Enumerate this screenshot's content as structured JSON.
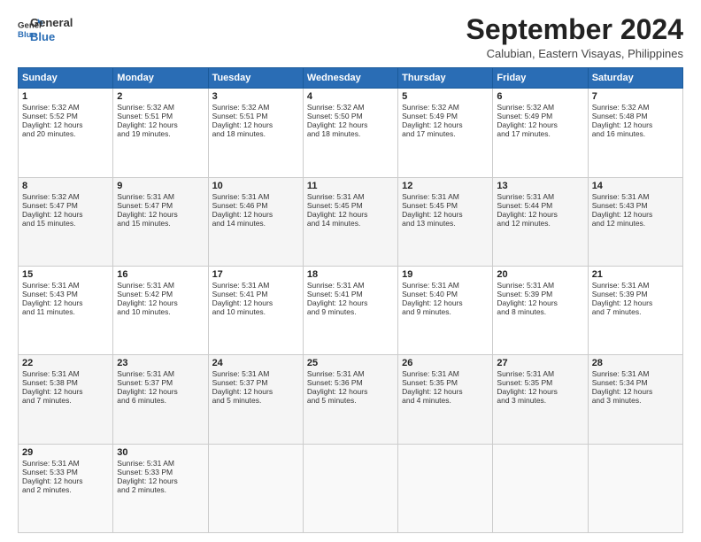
{
  "logo": {
    "line1": "General",
    "line2": "Blue"
  },
  "header": {
    "month": "September 2024",
    "location": "Calubian, Eastern Visayas, Philippines"
  },
  "weekdays": [
    "Sunday",
    "Monday",
    "Tuesday",
    "Wednesday",
    "Thursday",
    "Friday",
    "Saturday"
  ],
  "weeks": [
    [
      {
        "day": "1",
        "sun": "5:32 AM",
        "set": "5:52 PM",
        "dl": "12 hours and 20 minutes."
      },
      {
        "day": "2",
        "sun": "5:32 AM",
        "set": "5:51 PM",
        "dl": "12 hours and 19 minutes."
      },
      {
        "day": "3",
        "sun": "5:32 AM",
        "set": "5:51 PM",
        "dl": "12 hours and 18 minutes."
      },
      {
        "day": "4",
        "sun": "5:32 AM",
        "set": "5:50 PM",
        "dl": "12 hours and 18 minutes."
      },
      {
        "day": "5",
        "sun": "5:32 AM",
        "set": "5:49 PM",
        "dl": "12 hours and 17 minutes."
      },
      {
        "day": "6",
        "sun": "5:32 AM",
        "set": "5:49 PM",
        "dl": "12 hours and 17 minutes."
      },
      {
        "day": "7",
        "sun": "5:32 AM",
        "set": "5:48 PM",
        "dl": "12 hours and 16 minutes."
      }
    ],
    [
      {
        "day": "8",
        "sun": "5:32 AM",
        "set": "5:47 PM",
        "dl": "12 hours and 15 minutes."
      },
      {
        "day": "9",
        "sun": "5:31 AM",
        "set": "5:47 PM",
        "dl": "12 hours and 15 minutes."
      },
      {
        "day": "10",
        "sun": "5:31 AM",
        "set": "5:46 PM",
        "dl": "12 hours and 14 minutes."
      },
      {
        "day": "11",
        "sun": "5:31 AM",
        "set": "5:45 PM",
        "dl": "12 hours and 14 minutes."
      },
      {
        "day": "12",
        "sun": "5:31 AM",
        "set": "5:45 PM",
        "dl": "12 hours and 13 minutes."
      },
      {
        "day": "13",
        "sun": "5:31 AM",
        "set": "5:44 PM",
        "dl": "12 hours and 12 minutes."
      },
      {
        "day": "14",
        "sun": "5:31 AM",
        "set": "5:43 PM",
        "dl": "12 hours and 12 minutes."
      }
    ],
    [
      {
        "day": "15",
        "sun": "5:31 AM",
        "set": "5:43 PM",
        "dl": "12 hours and 11 minutes."
      },
      {
        "day": "16",
        "sun": "5:31 AM",
        "set": "5:42 PM",
        "dl": "12 hours and 10 minutes."
      },
      {
        "day": "17",
        "sun": "5:31 AM",
        "set": "5:41 PM",
        "dl": "12 hours and 10 minutes."
      },
      {
        "day": "18",
        "sun": "5:31 AM",
        "set": "5:41 PM",
        "dl": "12 hours and 9 minutes."
      },
      {
        "day": "19",
        "sun": "5:31 AM",
        "set": "5:40 PM",
        "dl": "12 hours and 9 minutes."
      },
      {
        "day": "20",
        "sun": "5:31 AM",
        "set": "5:39 PM",
        "dl": "12 hours and 8 minutes."
      },
      {
        "day": "21",
        "sun": "5:31 AM",
        "set": "5:39 PM",
        "dl": "12 hours and 7 minutes."
      }
    ],
    [
      {
        "day": "22",
        "sun": "5:31 AM",
        "set": "5:38 PM",
        "dl": "12 hours and 7 minutes."
      },
      {
        "day": "23",
        "sun": "5:31 AM",
        "set": "5:37 PM",
        "dl": "12 hours and 6 minutes."
      },
      {
        "day": "24",
        "sun": "5:31 AM",
        "set": "5:37 PM",
        "dl": "12 hours and 5 minutes."
      },
      {
        "day": "25",
        "sun": "5:31 AM",
        "set": "5:36 PM",
        "dl": "12 hours and 5 minutes."
      },
      {
        "day": "26",
        "sun": "5:31 AM",
        "set": "5:35 PM",
        "dl": "12 hours and 4 minutes."
      },
      {
        "day": "27",
        "sun": "5:31 AM",
        "set": "5:35 PM",
        "dl": "12 hours and 3 minutes."
      },
      {
        "day": "28",
        "sun": "5:31 AM",
        "set": "5:34 PM",
        "dl": "12 hours and 3 minutes."
      }
    ],
    [
      {
        "day": "29",
        "sun": "5:31 AM",
        "set": "5:33 PM",
        "dl": "12 hours and 2 minutes."
      },
      {
        "day": "30",
        "sun": "5:31 AM",
        "set": "5:33 PM",
        "dl": "12 hours and 2 minutes."
      },
      null,
      null,
      null,
      null,
      null
    ]
  ],
  "labels": {
    "sunrise": "Sunrise:",
    "sunset": "Sunset:",
    "daylight": "Daylight:"
  }
}
